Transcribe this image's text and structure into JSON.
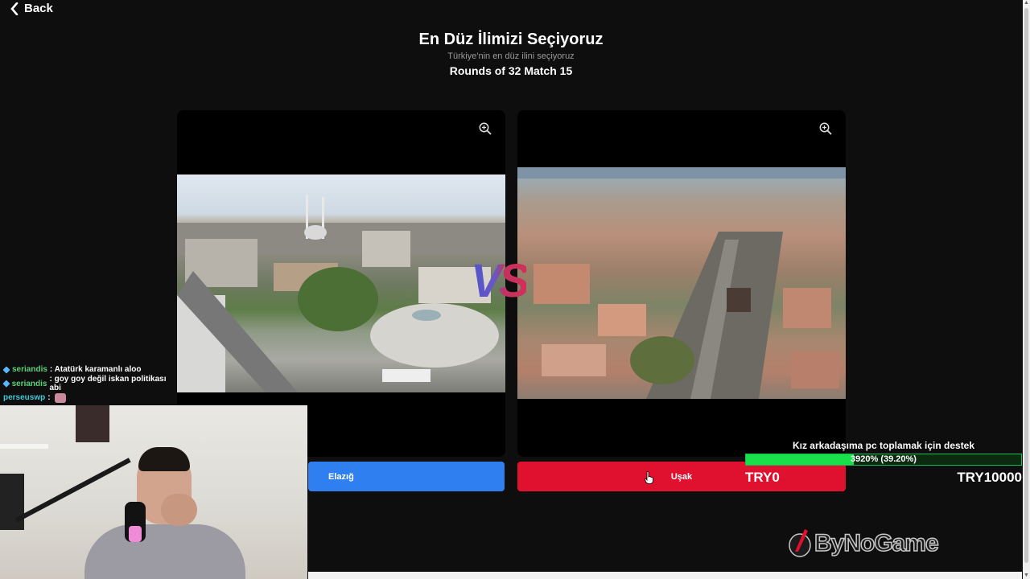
{
  "nav": {
    "back_label": "Back"
  },
  "header": {
    "title": "En Düz İlimizi Seçiyoruz",
    "subtitle": "Türkiye'nin en düz ilini seçiyoruz",
    "round": "Rounds of 32 Match 15"
  },
  "versus_label": "VS",
  "options": [
    {
      "label": "Elazığ",
      "color": "#2f7ff0"
    },
    {
      "label": "Uşak",
      "color": "#e0102f"
    }
  ],
  "chat": [
    {
      "user": "seriandis",
      "message": ": Atatürk karamanlı aloo",
      "badge": true
    },
    {
      "user": "seriandis",
      "message": ": goy goy değil iskan politikası abi",
      "badge": true
    },
    {
      "user": "perseuswp",
      "message": ":",
      "badge": false,
      "emote": true
    }
  ],
  "donation_goal": {
    "title": "Kız arkadaşıma pc toplamak için destek",
    "progress_text": "3920% (39.20%)",
    "progress_fraction": 0.392,
    "current": "TRY0",
    "target": "TRY10000"
  },
  "icons": {
    "back": "chevron-left-icon",
    "zoom": "zoom-in-icon",
    "cursor": "hand-pointer-icon"
  },
  "brand": {
    "name": "ByNoGame"
  }
}
